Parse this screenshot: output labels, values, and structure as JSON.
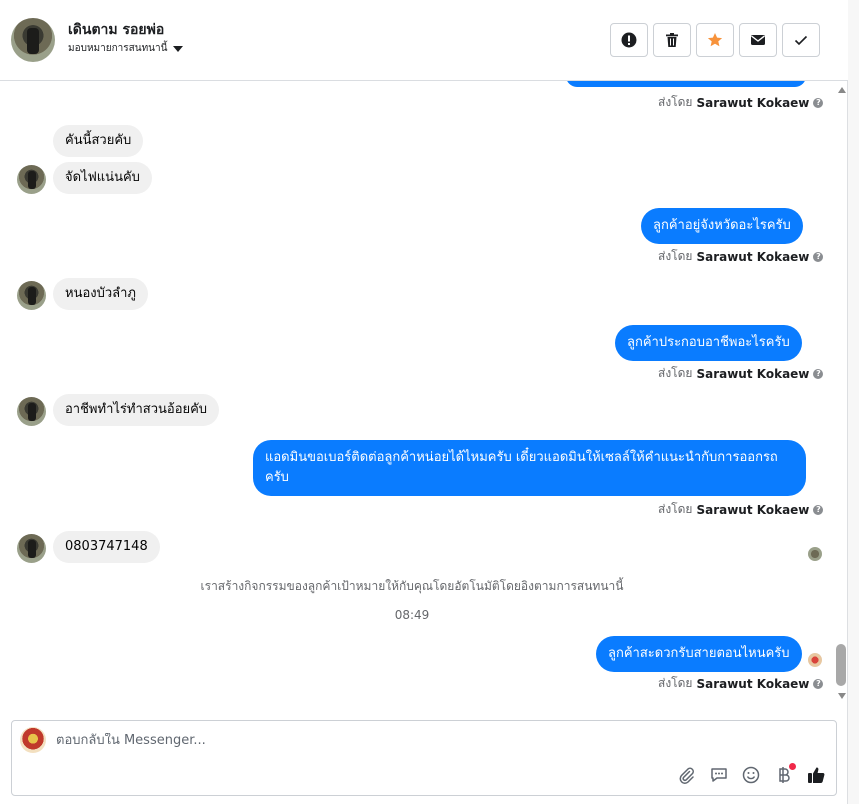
{
  "header": {
    "contact_name": "เดินตาม รอยพ่อ",
    "assign_label": "มอบหมายการสนทนานี้",
    "buttons": [
      {
        "name": "mark-spam-button",
        "icon": "exclamation-icon"
      },
      {
        "name": "delete-button",
        "icon": "trash-icon"
      },
      {
        "name": "star-button",
        "icon": "star-icon",
        "color": "#f7923b"
      },
      {
        "name": "mark-unread-button",
        "icon": "envelope-icon"
      },
      {
        "name": "mark-done-button",
        "icon": "check-icon"
      }
    ]
  },
  "messages": {
    "sent_by_label": "ส่งโดย",
    "sender_name": "Sarawut Kokaew",
    "in_1": "คันนี้สวยคับ",
    "in_2": "จัดไฟแน่นคับ",
    "out_1": "ลูกค้าอยู่จังหวัดอะไรครับ",
    "in_3": "หนองบัวลำภู",
    "out_2": "ลูกค้าประกอบอาชีพอะไรครับ",
    "in_4": "อาชีพทำไร่ทำสวนอ้อยคับ",
    "out_3": "แอดมินขอเบอร์ติดต่อลูกค้าหน่อยได้ไหมครับ เดี๋ยวแอดมินให้เซลล์ให้คำแนะนำกับการออกรถครับ",
    "in_5": "0803747148",
    "system_note": "เราสร้างกิจกรรมของลูกค้าเป้าหมายให้กับคุณโดยอัตโนมัติโดยอิงตามการสนทนานี้",
    "timestamp": "08:49",
    "out_4": "ลูกค้าสะดวกรับสายตอนไหนครับ"
  },
  "composer": {
    "placeholder": "ตอบกลับใน Messenger...",
    "icons": [
      "paperclip-icon",
      "saved-replies-icon",
      "emoji-icon",
      "baht-icon",
      "thumbs-up-icon"
    ]
  },
  "colors": {
    "outgoing_bubble": "#0a7cff",
    "incoming_bubble": "#f0f0f0",
    "star": "#f7923b",
    "notification_dot": "#f02849"
  }
}
